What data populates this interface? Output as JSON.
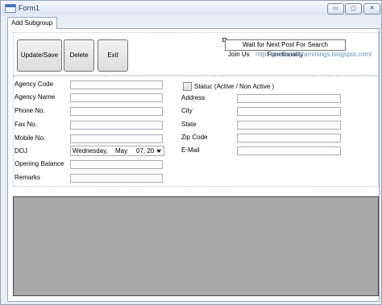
{
  "window": {
    "title": "Form1",
    "min_glyph": "▭",
    "max_glyph": "▢",
    "close_glyph": "✕"
  },
  "tabs": [
    {
      "label": "Add Subgroup"
    }
  ],
  "toolbar": {
    "update_label": "Update/Save",
    "delete_label": "Delete",
    "exit_label": "Exit"
  },
  "notice": {
    "text": "Wait for Next Post For Search Functionality",
    "join_label": "Join Us",
    "link": "http://geeksprogrammings.blogspot.com/"
  },
  "form": {
    "left_labels": {
      "agency_code": "Agency Code",
      "agency_name": "Agency Name",
      "phone": "Phone No.",
      "fax": "Fax No.",
      "mobile": "Mobile No.",
      "doj": "DOJ",
      "opening_balance": "Opening Balance",
      "remarks": "Remarks"
    },
    "doj_value": {
      "weekday": "Wednesday,",
      "month": "May",
      "day_year": "07, 20"
    },
    "status_checkbox": {
      "label": "Statuc (Active / Non Active )",
      "checked": false
    },
    "right_labels": {
      "address": "Address",
      "city": "City",
      "state": "State",
      "zip": "Zip Code",
      "email": "E-Mail"
    }
  },
  "colors": {
    "link": "#6e8fb8",
    "grid_area": "#a8a8a8"
  }
}
